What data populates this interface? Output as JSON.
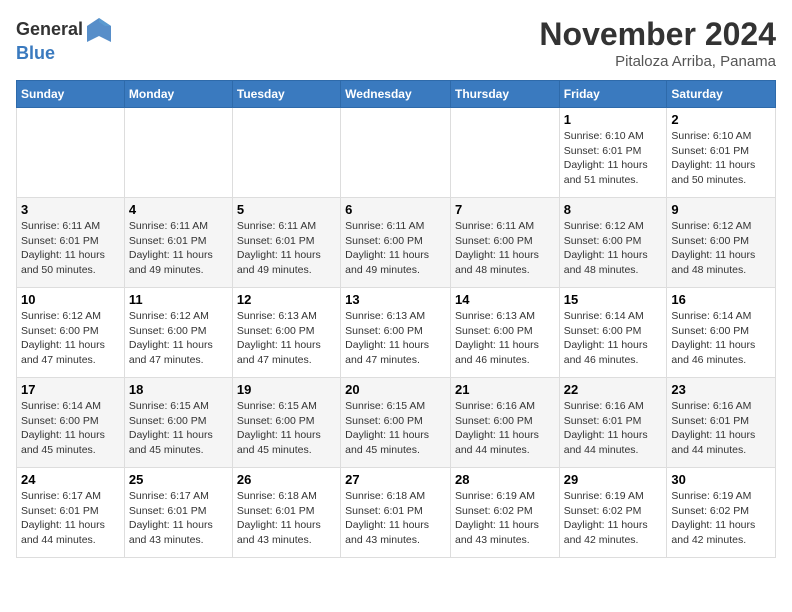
{
  "header": {
    "logo_general": "General",
    "logo_blue": "Blue",
    "month_title": "November 2024",
    "subtitle": "Pitaloza Arriba, Panama"
  },
  "days_of_week": [
    "Sunday",
    "Monday",
    "Tuesday",
    "Wednesday",
    "Thursday",
    "Friday",
    "Saturday"
  ],
  "weeks": [
    [
      {
        "day": "",
        "info": ""
      },
      {
        "day": "",
        "info": ""
      },
      {
        "day": "",
        "info": ""
      },
      {
        "day": "",
        "info": ""
      },
      {
        "day": "",
        "info": ""
      },
      {
        "day": "1",
        "info": "Sunrise: 6:10 AM\nSunset: 6:01 PM\nDaylight: 11 hours and 51 minutes."
      },
      {
        "day": "2",
        "info": "Sunrise: 6:10 AM\nSunset: 6:01 PM\nDaylight: 11 hours and 50 minutes."
      }
    ],
    [
      {
        "day": "3",
        "info": "Sunrise: 6:11 AM\nSunset: 6:01 PM\nDaylight: 11 hours and 50 minutes."
      },
      {
        "day": "4",
        "info": "Sunrise: 6:11 AM\nSunset: 6:01 PM\nDaylight: 11 hours and 49 minutes."
      },
      {
        "day": "5",
        "info": "Sunrise: 6:11 AM\nSunset: 6:01 PM\nDaylight: 11 hours and 49 minutes."
      },
      {
        "day": "6",
        "info": "Sunrise: 6:11 AM\nSunset: 6:00 PM\nDaylight: 11 hours and 49 minutes."
      },
      {
        "day": "7",
        "info": "Sunrise: 6:11 AM\nSunset: 6:00 PM\nDaylight: 11 hours and 48 minutes."
      },
      {
        "day": "8",
        "info": "Sunrise: 6:12 AM\nSunset: 6:00 PM\nDaylight: 11 hours and 48 minutes."
      },
      {
        "day": "9",
        "info": "Sunrise: 6:12 AM\nSunset: 6:00 PM\nDaylight: 11 hours and 48 minutes."
      }
    ],
    [
      {
        "day": "10",
        "info": "Sunrise: 6:12 AM\nSunset: 6:00 PM\nDaylight: 11 hours and 47 minutes."
      },
      {
        "day": "11",
        "info": "Sunrise: 6:12 AM\nSunset: 6:00 PM\nDaylight: 11 hours and 47 minutes."
      },
      {
        "day": "12",
        "info": "Sunrise: 6:13 AM\nSunset: 6:00 PM\nDaylight: 11 hours and 47 minutes."
      },
      {
        "day": "13",
        "info": "Sunrise: 6:13 AM\nSunset: 6:00 PM\nDaylight: 11 hours and 47 minutes."
      },
      {
        "day": "14",
        "info": "Sunrise: 6:13 AM\nSunset: 6:00 PM\nDaylight: 11 hours and 46 minutes."
      },
      {
        "day": "15",
        "info": "Sunrise: 6:14 AM\nSunset: 6:00 PM\nDaylight: 11 hours and 46 minutes."
      },
      {
        "day": "16",
        "info": "Sunrise: 6:14 AM\nSunset: 6:00 PM\nDaylight: 11 hours and 46 minutes."
      }
    ],
    [
      {
        "day": "17",
        "info": "Sunrise: 6:14 AM\nSunset: 6:00 PM\nDaylight: 11 hours and 45 minutes."
      },
      {
        "day": "18",
        "info": "Sunrise: 6:15 AM\nSunset: 6:00 PM\nDaylight: 11 hours and 45 minutes."
      },
      {
        "day": "19",
        "info": "Sunrise: 6:15 AM\nSunset: 6:00 PM\nDaylight: 11 hours and 45 minutes."
      },
      {
        "day": "20",
        "info": "Sunrise: 6:15 AM\nSunset: 6:00 PM\nDaylight: 11 hours and 45 minutes."
      },
      {
        "day": "21",
        "info": "Sunrise: 6:16 AM\nSunset: 6:00 PM\nDaylight: 11 hours and 44 minutes."
      },
      {
        "day": "22",
        "info": "Sunrise: 6:16 AM\nSunset: 6:01 PM\nDaylight: 11 hours and 44 minutes."
      },
      {
        "day": "23",
        "info": "Sunrise: 6:16 AM\nSunset: 6:01 PM\nDaylight: 11 hours and 44 minutes."
      }
    ],
    [
      {
        "day": "24",
        "info": "Sunrise: 6:17 AM\nSunset: 6:01 PM\nDaylight: 11 hours and 44 minutes."
      },
      {
        "day": "25",
        "info": "Sunrise: 6:17 AM\nSunset: 6:01 PM\nDaylight: 11 hours and 43 minutes."
      },
      {
        "day": "26",
        "info": "Sunrise: 6:18 AM\nSunset: 6:01 PM\nDaylight: 11 hours and 43 minutes."
      },
      {
        "day": "27",
        "info": "Sunrise: 6:18 AM\nSunset: 6:01 PM\nDaylight: 11 hours and 43 minutes."
      },
      {
        "day": "28",
        "info": "Sunrise: 6:19 AM\nSunset: 6:02 PM\nDaylight: 11 hours and 43 minutes."
      },
      {
        "day": "29",
        "info": "Sunrise: 6:19 AM\nSunset: 6:02 PM\nDaylight: 11 hours and 42 minutes."
      },
      {
        "day": "30",
        "info": "Sunrise: 6:19 AM\nSunset: 6:02 PM\nDaylight: 11 hours and 42 minutes."
      }
    ]
  ]
}
